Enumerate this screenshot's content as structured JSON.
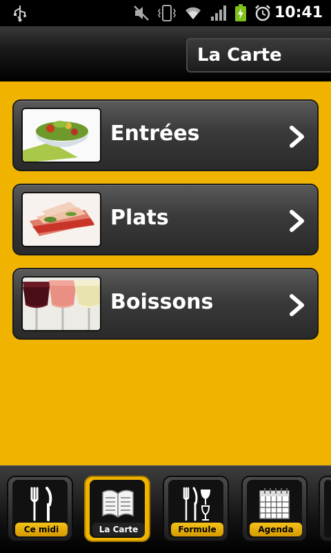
{
  "status_bar": {
    "time": "10:41",
    "icons": [
      "usb-icon",
      "mute-icon",
      "vibrate-icon",
      "wifi-icon",
      "signal-icon",
      "battery-charging-icon",
      "alarm-icon"
    ]
  },
  "header": {
    "title": "La Carte"
  },
  "menu": {
    "items": [
      {
        "label": "Entrées",
        "image": "salad-image"
      },
      {
        "label": "Plats",
        "image": "fish-dish-image"
      },
      {
        "label": "Boissons",
        "image": "wine-glasses-image"
      }
    ]
  },
  "bottom_nav": {
    "items": [
      {
        "label": "Ce midi",
        "icon": "fork-knife-icon",
        "active": false
      },
      {
        "label": "La Carte",
        "icon": "open-book-icon",
        "active": true
      },
      {
        "label": "Formule",
        "icon": "cutlery-glass-icon",
        "active": false
      },
      {
        "label": "Agenda",
        "icon": "calendar-icon",
        "active": false
      }
    ]
  },
  "colors": {
    "background": "#f0b400",
    "card": "#3a3a3a",
    "header": "#000000"
  }
}
